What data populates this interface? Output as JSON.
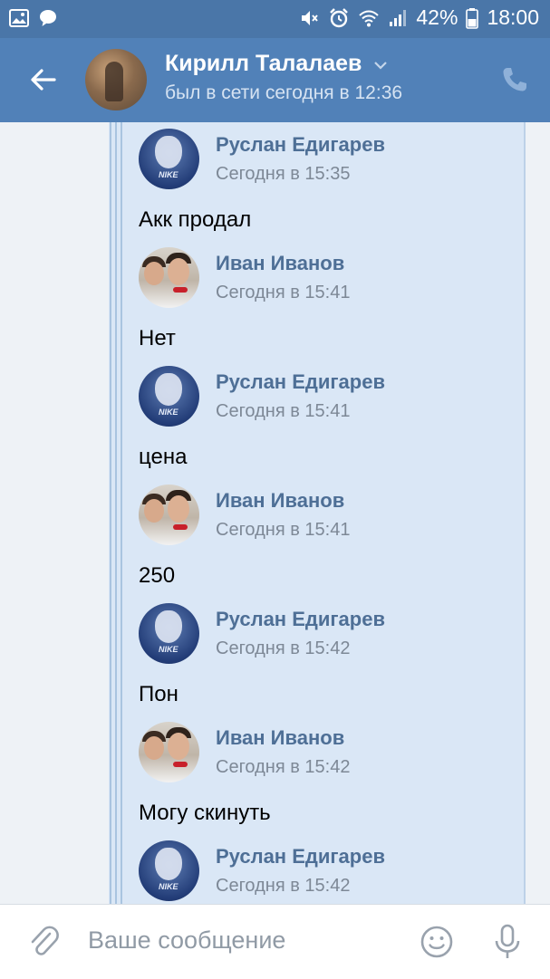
{
  "status_bar": {
    "battery_percent": "42%",
    "time": "18:00",
    "icons": [
      "gallery-icon",
      "chat-bubble-icon",
      "mute-icon",
      "alarm-icon",
      "wifi-icon",
      "signal-icon",
      "battery-icon"
    ]
  },
  "header": {
    "contact_name": "Кирилл Талалаев",
    "last_seen": "был в сети сегодня в 12:36"
  },
  "messages": [
    {
      "sender": "Руслан Едигарев",
      "time": "Сегодня в 15:35",
      "text": "Акк продал",
      "avatar": "ruslan"
    },
    {
      "sender": "Иван Иванов",
      "time": "Сегодня в 15:41",
      "text": "Нет",
      "avatar": "ivan"
    },
    {
      "sender": "Руслан Едигарев",
      "time": "Сегодня в 15:41",
      "text": "цена",
      "avatar": "ruslan"
    },
    {
      "sender": "Иван Иванов",
      "time": "Сегодня в 15:41",
      "text": "250",
      "avatar": "ivan"
    },
    {
      "sender": "Руслан Едигарев",
      "time": "Сегодня в 15:42",
      "text": "Пон",
      "avatar": "ruslan"
    },
    {
      "sender": "Иван Иванов",
      "time": "Сегодня в 15:42",
      "text": "Могу скинуть",
      "avatar": "ivan"
    },
    {
      "sender": "Руслан Едигарев",
      "time": "Сегодня в 15:42",
      "text": "",
      "avatar": "ruslan"
    }
  ],
  "composer": {
    "placeholder": "Ваше сообщение"
  },
  "colors": {
    "status_bar": "#4a76a8",
    "header": "#5181b8",
    "forward_bg": "#dae7f6",
    "sender_name": "#4e6f96"
  }
}
